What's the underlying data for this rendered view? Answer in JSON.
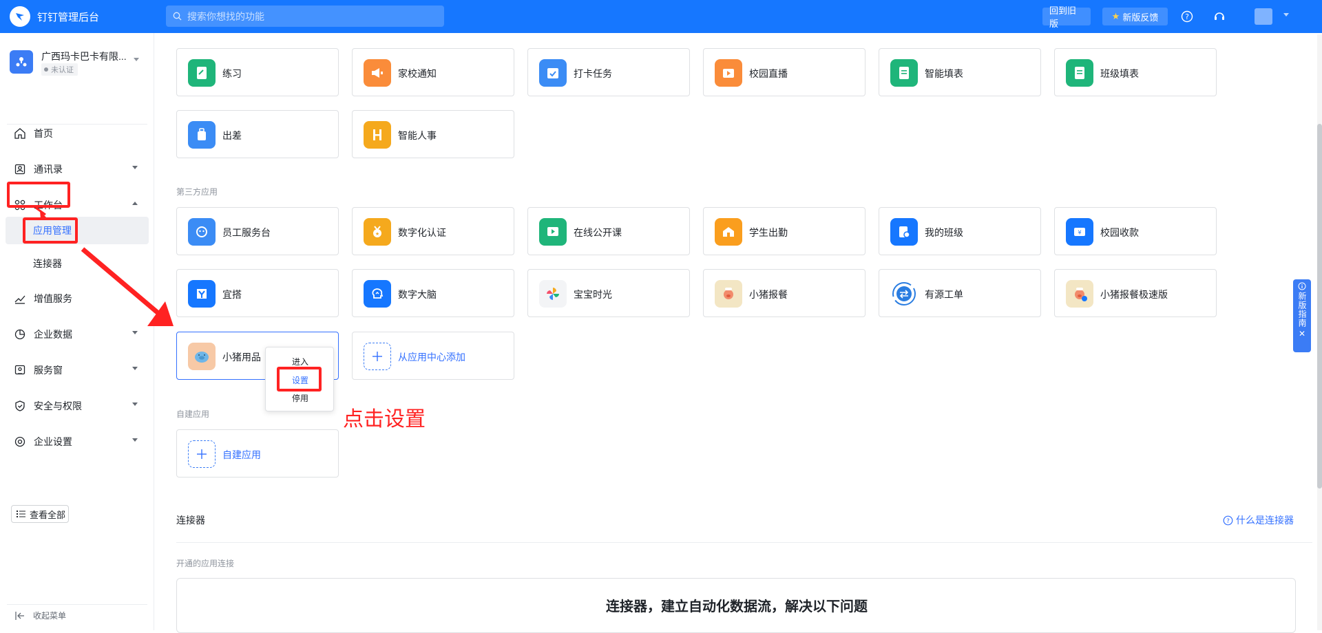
{
  "header": {
    "app_title": "钉钉管理后台",
    "search_placeholder": "搜索你想找的功能",
    "old_version": "回到旧版",
    "feedback": "新版反馈",
    "brand_color": "#1677ff"
  },
  "sidebar": {
    "org_name": "广西玛卡巴卡有限...",
    "org_status": "未认证",
    "items": [
      {
        "label": "首页",
        "icon": "home-icon"
      },
      {
        "label": "通讯录",
        "icon": "contacts-icon"
      },
      {
        "label": "工作台",
        "icon": "grid-icon"
      },
      {
        "label": "增值服务",
        "icon": "trend-icon"
      },
      {
        "label": "企业数据",
        "icon": "pie-icon"
      },
      {
        "label": "服务窗",
        "icon": "service-icon"
      },
      {
        "label": "安全与权限",
        "icon": "shield-icon"
      },
      {
        "label": "企业设置",
        "icon": "settings-icon"
      }
    ],
    "sub_items": [
      "应用管理",
      "连接器"
    ],
    "view_all": "查看全部",
    "collapse": "收起菜单"
  },
  "main": {
    "apps_row1": [
      "练习",
      "家校通知",
      "打卡任务",
      "校园直播",
      "智能填表",
      "班级填表"
    ],
    "apps_row2": [
      "出差",
      "智能人事"
    ],
    "third_party_label": "第三方应用",
    "third_row1": [
      "员工服务台",
      "数字化认证",
      "在线公开课",
      "学生出勤",
      "我的班级",
      "校园收款"
    ],
    "third_row2": [
      "宜搭",
      "数字大脑",
      "宝宝时光",
      "小猪报餐",
      "有源工单",
      "小猪报餐极速版"
    ],
    "third_row3_app": "小猪用品",
    "add_from_center": "从应用中心添加",
    "custom_label": "自建应用",
    "custom_app": "自建应用",
    "context_menu": [
      "进入",
      "设置",
      "停用"
    ],
    "annotation": "点击设置",
    "connector_title": "连接器",
    "connector_help": "什么是连接器",
    "connector_sub": "开通的应用连接",
    "connector_banner": "连接器，建立自动化数据流，解决以下问题"
  },
  "guide": {
    "text": "新版指南"
  }
}
